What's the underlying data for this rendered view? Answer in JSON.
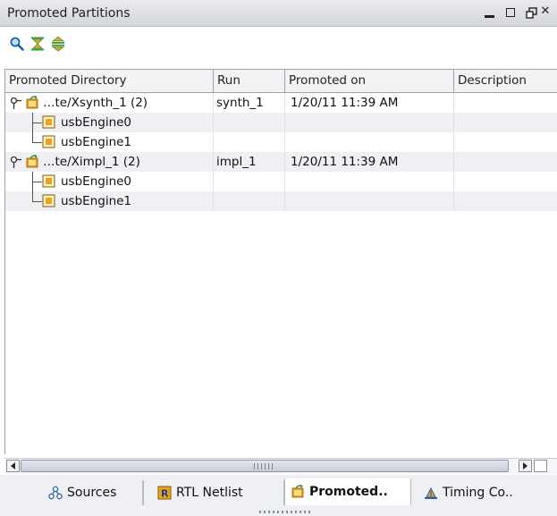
{
  "window": {
    "title": "Promoted Partitions"
  },
  "icons": {
    "search": "search-icon",
    "collapse_all": "collapse-all-icon",
    "expand_all": "expand-all-icon"
  },
  "table": {
    "columns": [
      "Promoted Directory",
      "Run",
      "Promoted on",
      "Description"
    ],
    "rows": [
      {
        "dir": "…te/Xsynth_1 (2)",
        "run": "synth_1",
        "promoted_on": "1/20/11 11:39 AM",
        "description": ""
      },
      {
        "dir": "usbEngine0",
        "run": "",
        "promoted_on": "",
        "description": ""
      },
      {
        "dir": "usbEngine1",
        "run": "",
        "promoted_on": "",
        "description": ""
      },
      {
        "dir": "…te/Ximpl_1 (2)",
        "run": "impl_1",
        "promoted_on": "1/20/11 11:39 AM",
        "description": ""
      },
      {
        "dir": "usbEngine0",
        "run": "",
        "promoted_on": "",
        "description": ""
      },
      {
        "dir": "usbEngine1",
        "run": "",
        "promoted_on": "",
        "description": ""
      }
    ]
  },
  "tabs": [
    {
      "label": "Sources",
      "icon": "sources-icon"
    },
    {
      "label": "RTL Netlist",
      "icon": "rtl-netlist-icon"
    },
    {
      "label": "Promoted..",
      "icon": "promoted-icon",
      "active": true
    },
    {
      "label": "Timing Co..",
      "icon": "timing-icon"
    }
  ],
  "colors": {
    "accent_orange": "#f0a020",
    "icon_green": "#3c9a3c",
    "tree_line": "#555555"
  }
}
